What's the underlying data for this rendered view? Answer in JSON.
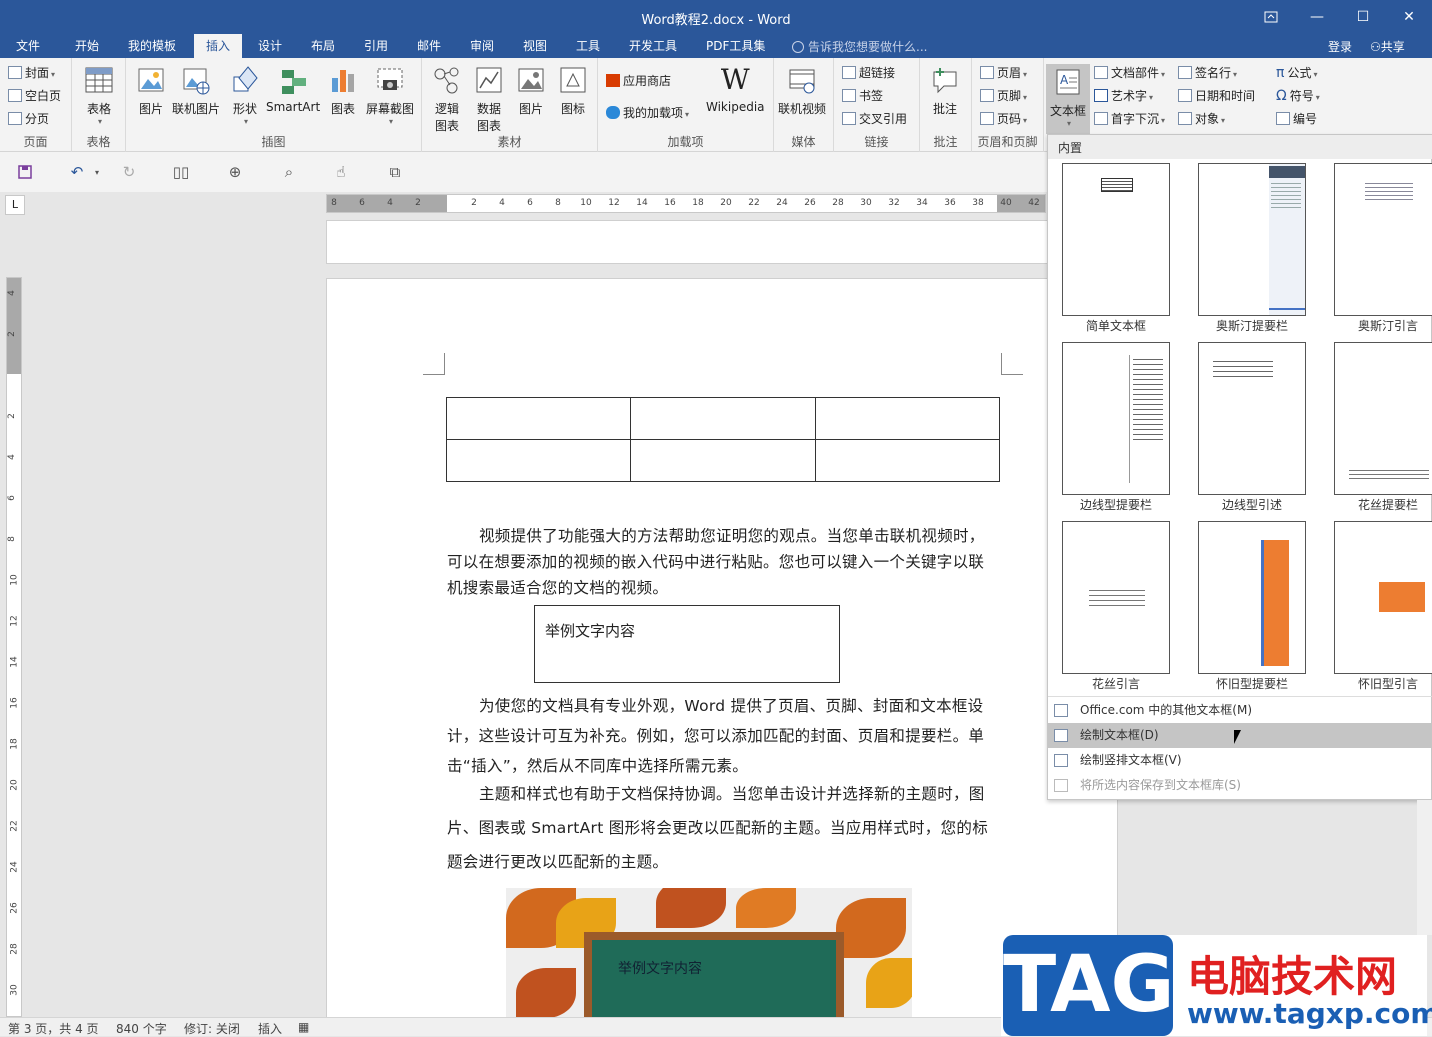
{
  "titlebar": {
    "title": "Word教程2.docx - Word",
    "ribbon_display_icon": "ribbon-display-icon",
    "minimize": "—",
    "maximize": "☐",
    "close": "✕"
  },
  "tabs": [
    "文件",
    "开始",
    "我的模板",
    "插入",
    "设计",
    "布局",
    "引用",
    "邮件",
    "审阅",
    "视图",
    "工具",
    "开发工具",
    "PDF工具集"
  ],
  "active_tab": "插入",
  "tellme": "告诉我您想要做什么...",
  "login": "登录",
  "share": "共享",
  "ribbon": {
    "pages": {
      "cover": "封面",
      "blank": "空白页",
      "break": "分页",
      "label": "页面"
    },
    "tables": {
      "table": "表格",
      "label": "表格"
    },
    "illustrations": {
      "picture": "图片",
      "online_picture": "联机图片",
      "shapes": "形状",
      "smartart": "SmartArt",
      "chart": "图表",
      "screenshot": "屏幕截图",
      "label": "插图"
    },
    "materials": {
      "logic_chart": "逻辑\n图表",
      "data_chart": "数据\n图表",
      "picture": "图片",
      "icon": "图标",
      "label": "素材"
    },
    "addins": {
      "store": "应用商店",
      "my_addins": "我的加载项",
      "wikipedia": "Wikipedia",
      "label": "加载项"
    },
    "media": {
      "online_video": "联机视频",
      "label": "媒体"
    },
    "links": {
      "hyperlink": "超链接",
      "bookmark": "书签",
      "cross_ref": "交叉引用",
      "label": "链接"
    },
    "comments": {
      "comment": "批注",
      "label": "批注"
    },
    "header_footer": {
      "header": "页眉",
      "footer": "页脚",
      "page_number": "页码",
      "label": "页眉和页脚"
    },
    "text": {
      "textbox": "文本框",
      "quickparts": "文档部件",
      "wordart": "艺术字",
      "dropcap": "首字下沉",
      "signature": "签名行",
      "datetime": "日期和时间",
      "object": "对象"
    },
    "symbols": {
      "equation": "公式",
      "symbol": "符号",
      "number": "编号"
    }
  },
  "ruler": {
    "ticks": [
      "8",
      "6",
      "4",
      "2",
      "",
      "2",
      "4",
      "6",
      "8",
      "10",
      "12",
      "14",
      "16",
      "18",
      "20",
      "22",
      "24",
      "26",
      "28",
      "30",
      "32",
      "34",
      "36",
      "38",
      "40",
      "42"
    ]
  },
  "vruler": {
    "ticks": [
      "4",
      "2",
      "",
      "2",
      "4",
      "6",
      "8",
      "10",
      "12",
      "14",
      "16",
      "18",
      "20",
      "22",
      "24",
      "26",
      "28",
      "30"
    ]
  },
  "document": {
    "para1": "视频提供了功能强大的方法帮助您证明您的观点。当您单击联机视频时，可以在想要添加的视频的嵌入代码中进行粘贴。您也可以键入一个关键字以联机搜索最适合您的文档的视频。",
    "textbox": "举例文字内容",
    "para2": "为使您的文档具有专业外观，Word 提供了页眉、页脚、封面和文本框设计，这些设计可互为补充。例如，您可以添加匹配的封面、页眉和提要栏。单击“插入”，然后从不同库中选择所需元素。",
    "para3": "主题和样式也有助于文档保持协调。当您单击设计并选择新的主题时，图片、图表或 SmartArt 图形将会更改以匹配新的主题。当应用样式时，您的标题会进行更改以匹配新的主题。",
    "picture_text": "举例文字内容"
  },
  "gallery": {
    "title": "内置",
    "items": [
      "简单文本框",
      "奥斯汀提要栏",
      "奥斯汀引言",
      "边线型提要栏",
      "边线型引述",
      "花丝提要栏",
      "花丝引言",
      "怀旧型提要栏",
      "怀旧型引言"
    ],
    "menu": [
      "Office.com 中的其他文本框(M)",
      "绘制文本框(D)",
      "绘制竖排文本框(V)",
      "将所选内容保存到文本框库(S)"
    ]
  },
  "status": {
    "page": "第 3 页，共 4 页",
    "words": "840 个字",
    "track": "修订: 关闭",
    "mode": "插入"
  },
  "watermark": {
    "tag": "TAG",
    "cn": "电脑技术网",
    "url": "www.tagxp.com"
  },
  "colors": {
    "accent": "#2b579a",
    "orange": "#ed7d31"
  }
}
